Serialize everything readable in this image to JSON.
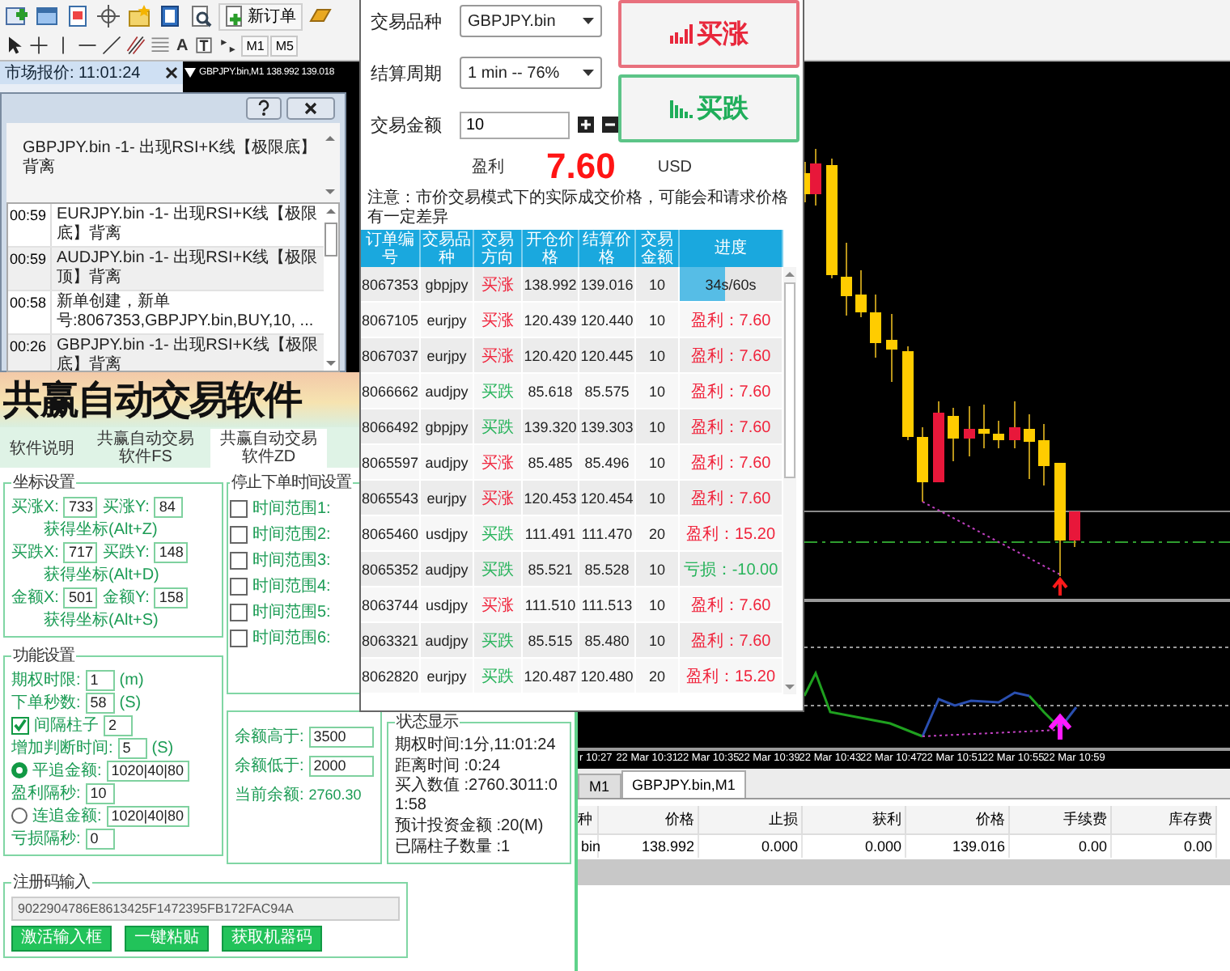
{
  "toolbar": {
    "new_order": "新订单",
    "text_tool": "A",
    "timeframes": [
      "M1",
      "M5"
    ]
  },
  "market_watch": {
    "title": "市场报价: 11:01:24"
  },
  "alert_window": {
    "message": "GBPJPY.bin -1- 出现RSI+K线【极限底】背离",
    "log": [
      {
        "time": "00:59",
        "text": "EURJPY.bin -1- 出现RSI+K线【极限底】背离"
      },
      {
        "time": "00:59",
        "text": "AUDJPY.bin -1- 出现RSI+K线【极限顶】背离"
      },
      {
        "time": "00:58",
        "text": "新单创建，新单号:8067353,GBPJPY.bin,BUY,10, ..."
      },
      {
        "time": "00:26",
        "text": "GBPJPY.bin -1- 出现RSI+K线【极限底】背离"
      }
    ]
  },
  "chart": {
    "title": "GBPJPY.bin,M1 138.992 139.018",
    "time_labels": [
      "r 10:27",
      "22 Mar 10:31",
      "22 Mar 10:35",
      "22 Mar 10:39",
      "22 Mar 10:43",
      "22 Mar 10:47",
      "22 Mar 10:51",
      "22 Mar 10:55",
      "22 Mar 10:59"
    ]
  },
  "chart_tabs": [
    {
      "label": "M1",
      "selected": false
    },
    {
      "label": "GBPJPY.bin,M1",
      "selected": true
    }
  ],
  "terminal": {
    "columns": [
      "种",
      "价格",
      "止损",
      "获利",
      "价格",
      "手续费",
      "库存费"
    ],
    "rows": [
      [
        "bin",
        "138.992",
        "0.000",
        "0.000",
        "139.016",
        "0.00",
        "0.00"
      ]
    ]
  },
  "trade_panel": {
    "fields": [
      {
        "label": "交易品种",
        "value": "GBPJPY.bin",
        "kind": "dropdown"
      },
      {
        "label": "结算周期",
        "value": "1 min -- 76%",
        "kind": "dropdown"
      },
      {
        "label": "交易金额",
        "value": "10",
        "kind": "stepper"
      }
    ],
    "buy_up": "买涨",
    "buy_down": "买跌",
    "profit_label": "盈利",
    "profit": "7.60",
    "currency": "USD",
    "note": "注意：市价交易模式下的实际成交价格，可能会和请求价格有一定差异",
    "table": {
      "columns": [
        "订单编号",
        "交易品种",
        "交易方向",
        "开仓价格",
        "结算价格",
        "交易金额",
        "进度"
      ],
      "rows": [
        {
          "id": "8067353",
          "symbol": "gbpjpy",
          "direction": {
            "text": "买涨",
            "kind": "up"
          },
          "open": "138.992",
          "close": "139.016",
          "amount": "10",
          "result": {
            "kind": "progress",
            "text": "34s/60s",
            "level": 0.44
          }
        },
        {
          "id": "8067105",
          "symbol": "eurjpy",
          "direction": {
            "text": "买涨",
            "kind": "up"
          },
          "open": "120.439",
          "close": "120.440",
          "amount": "10",
          "result": {
            "kind": "profit",
            "text": "盈利：7.60"
          }
        },
        {
          "id": "8067037",
          "symbol": "eurjpy",
          "direction": {
            "text": "买涨",
            "kind": "up"
          },
          "open": "120.420",
          "close": "120.445",
          "amount": "10",
          "result": {
            "kind": "profit",
            "text": "盈利：7.60"
          }
        },
        {
          "id": "8066662",
          "symbol": "audjpy",
          "direction": {
            "text": "买跌",
            "kind": "down"
          },
          "open": "85.618",
          "close": "85.575",
          "amount": "10",
          "result": {
            "kind": "profit",
            "text": "盈利：7.60"
          }
        },
        {
          "id": "8066492",
          "symbol": "gbpjpy",
          "direction": {
            "text": "买跌",
            "kind": "down"
          },
          "open": "139.320",
          "close": "139.303",
          "amount": "10",
          "result": {
            "kind": "profit",
            "text": "盈利：7.60"
          }
        },
        {
          "id": "8065597",
          "symbol": "audjpy",
          "direction": {
            "text": "买涨",
            "kind": "up"
          },
          "open": "85.485",
          "close": "85.496",
          "amount": "10",
          "result": {
            "kind": "profit",
            "text": "盈利：7.60"
          }
        },
        {
          "id": "8065543",
          "symbol": "eurjpy",
          "direction": {
            "text": "买涨",
            "kind": "up"
          },
          "open": "120.453",
          "close": "120.454",
          "amount": "10",
          "result": {
            "kind": "profit",
            "text": "盈利：7.60"
          }
        },
        {
          "id": "8065460",
          "symbol": "usdjpy",
          "direction": {
            "text": "买跌",
            "kind": "down"
          },
          "open": "111.491",
          "close": "111.470",
          "amount": "20",
          "result": {
            "kind": "profit",
            "text": "盈利：15.20"
          }
        },
        {
          "id": "8065352",
          "symbol": "audjpy",
          "direction": {
            "text": "买跌",
            "kind": "down"
          },
          "open": "85.521",
          "close": "85.528",
          "amount": "10",
          "result": {
            "kind": "loss",
            "text": "亏损：-10.00"
          }
        },
        {
          "id": "8063744",
          "symbol": "usdjpy",
          "direction": {
            "text": "买涨",
            "kind": "up"
          },
          "open": "111.510",
          "close": "111.513",
          "amount": "10",
          "result": {
            "kind": "profit",
            "text": "盈利：7.60"
          }
        },
        {
          "id": "8063321",
          "symbol": "audjpy",
          "direction": {
            "text": "买跌",
            "kind": "down"
          },
          "open": "85.515",
          "close": "85.480",
          "amount": "10",
          "result": {
            "kind": "profit",
            "text": "盈利：7.60"
          }
        },
        {
          "id": "8062820",
          "symbol": "eurjpy",
          "direction": {
            "text": "买跌",
            "kind": "down"
          },
          "open": "120.487",
          "close": "120.480",
          "amount": "20",
          "result": {
            "kind": "profit",
            "text": "盈利：15.20"
          }
        }
      ]
    }
  },
  "software_window": {
    "banner": "共赢自动交易软件",
    "tabs": [
      {
        "label": "软件说明",
        "selected": false
      },
      {
        "label": "共赢自动交易软件FS",
        "selected": false
      },
      {
        "label": "共赢自动交易软件ZD",
        "selected": true
      }
    ],
    "coords": {
      "title": "坐标设置",
      "lines": [
        [
          {
            "kind": "label",
            "text": "买涨X:"
          },
          {
            "kind": "input",
            "value": "733"
          },
          {
            "kind": "label",
            "text": "买涨Y:"
          },
          {
            "kind": "input",
            "value": "84"
          }
        ],
        [
          {
            "kind": "link",
            "text": "获得坐标(Alt+Z)"
          }
        ],
        [
          {
            "kind": "label",
            "text": "买跌X:"
          },
          {
            "kind": "input",
            "value": "717"
          },
          {
            "kind": "label",
            "text": "买跌Y:"
          },
          {
            "kind": "input",
            "value": "148"
          }
        ],
        [
          {
            "kind": "link",
            "text": "获得坐标(Alt+D)"
          }
        ],
        [
          {
            "kind": "label",
            "text": "金额X:"
          },
          {
            "kind": "input",
            "value": "501"
          },
          {
            "kind": "label",
            "text": "金额Y:"
          },
          {
            "kind": "input",
            "value": "158"
          }
        ],
        [
          {
            "kind": "link",
            "text": "获得坐标(Alt+S)"
          }
        ]
      ]
    },
    "functions": {
      "title": "功能设置",
      "lines": [
        [
          {
            "kind": "label",
            "text": "期权时限:"
          },
          {
            "kind": "input",
            "value": "1"
          },
          {
            "kind": "label",
            "text": "(m)"
          }
        ],
        [
          {
            "kind": "label",
            "text": "下单秒数:"
          },
          {
            "kind": "input",
            "value": "58"
          },
          {
            "kind": "label",
            "text": "(S)"
          }
        ],
        [
          {
            "kind": "checkbox",
            "text": "间隔柱子",
            "checked": true
          },
          {
            "kind": "input",
            "value": "2"
          }
        ],
        [
          {
            "kind": "label",
            "text": "增加判断时间:"
          },
          {
            "kind": "input",
            "value": "5"
          },
          {
            "kind": "label",
            "text": "(S)"
          }
        ],
        [
          {
            "kind": "radio",
            "text": "平追金额:",
            "selected": true
          },
          {
            "kind": "input",
            "value": "1020|40|80"
          }
        ],
        [
          {
            "kind": "label",
            "text": "盈利隔秒:"
          },
          {
            "kind": "input",
            "value": "10"
          }
        ],
        [
          {
            "kind": "radio",
            "text": "连追金额:",
            "selected": false
          },
          {
            "kind": "input",
            "value": "1020|40|80"
          }
        ],
        [
          {
            "kind": "label",
            "text": "亏损隔秒:"
          },
          {
            "kind": "input",
            "value": "0"
          }
        ]
      ]
    },
    "stop_times": {
      "title": "停止下单时间设置",
      "lines": [
        [
          {
            "kind": "checkbox",
            "text": "时间范围1:",
            "checked": false
          }
        ],
        [
          {
            "kind": "checkbox",
            "text": "时间范围2:",
            "checked": false
          }
        ],
        [
          {
            "kind": "checkbox",
            "text": "时间范围3:",
            "checked": false
          }
        ],
        [
          {
            "kind": "checkbox",
            "text": "时间范围4:",
            "checked": false
          }
        ],
        [
          {
            "kind": "checkbox",
            "text": "时间范围5:",
            "checked": false
          }
        ],
        [
          {
            "kind": "checkbox",
            "text": "时间范围6:",
            "checked": false
          }
        ]
      ]
    },
    "balance": {
      "lines": [
        [
          {
            "kind": "label",
            "text": "余额高于:"
          },
          {
            "kind": "input",
            "value": "3500"
          }
        ],
        [
          {
            "kind": "label",
            "text": "余额低于:"
          },
          {
            "kind": "input",
            "value": "2000"
          }
        ],
        [
          {
            "kind": "label",
            "text": "当前余额:"
          },
          {
            "kind": "value",
            "text": "2760.30"
          }
        ]
      ]
    },
    "status": {
      "title": "状态显示",
      "lines": [
        [
          {
            "kind": "text",
            "text": "期权时间:1分,11:01:24"
          }
        ],
        [
          {
            "kind": "text",
            "text": "距离时间 :0:24"
          }
        ],
        [
          {
            "kind": "text",
            "text": "买入数值 :2760.3011:01:58"
          }
        ],
        [
          {
            "kind": "text",
            "text": "预计投资金额 :20(M)"
          }
        ],
        [
          {
            "kind": "text",
            "text": "已隔柱子数量 :1"
          }
        ]
      ]
    },
    "registration": {
      "title": "注册码输入",
      "code": "9022904786E8613425F1472395FB172FAC94A",
      "buttons": [
        "激活输入框",
        "一键粘贴",
        "获取机器码"
      ]
    }
  }
}
